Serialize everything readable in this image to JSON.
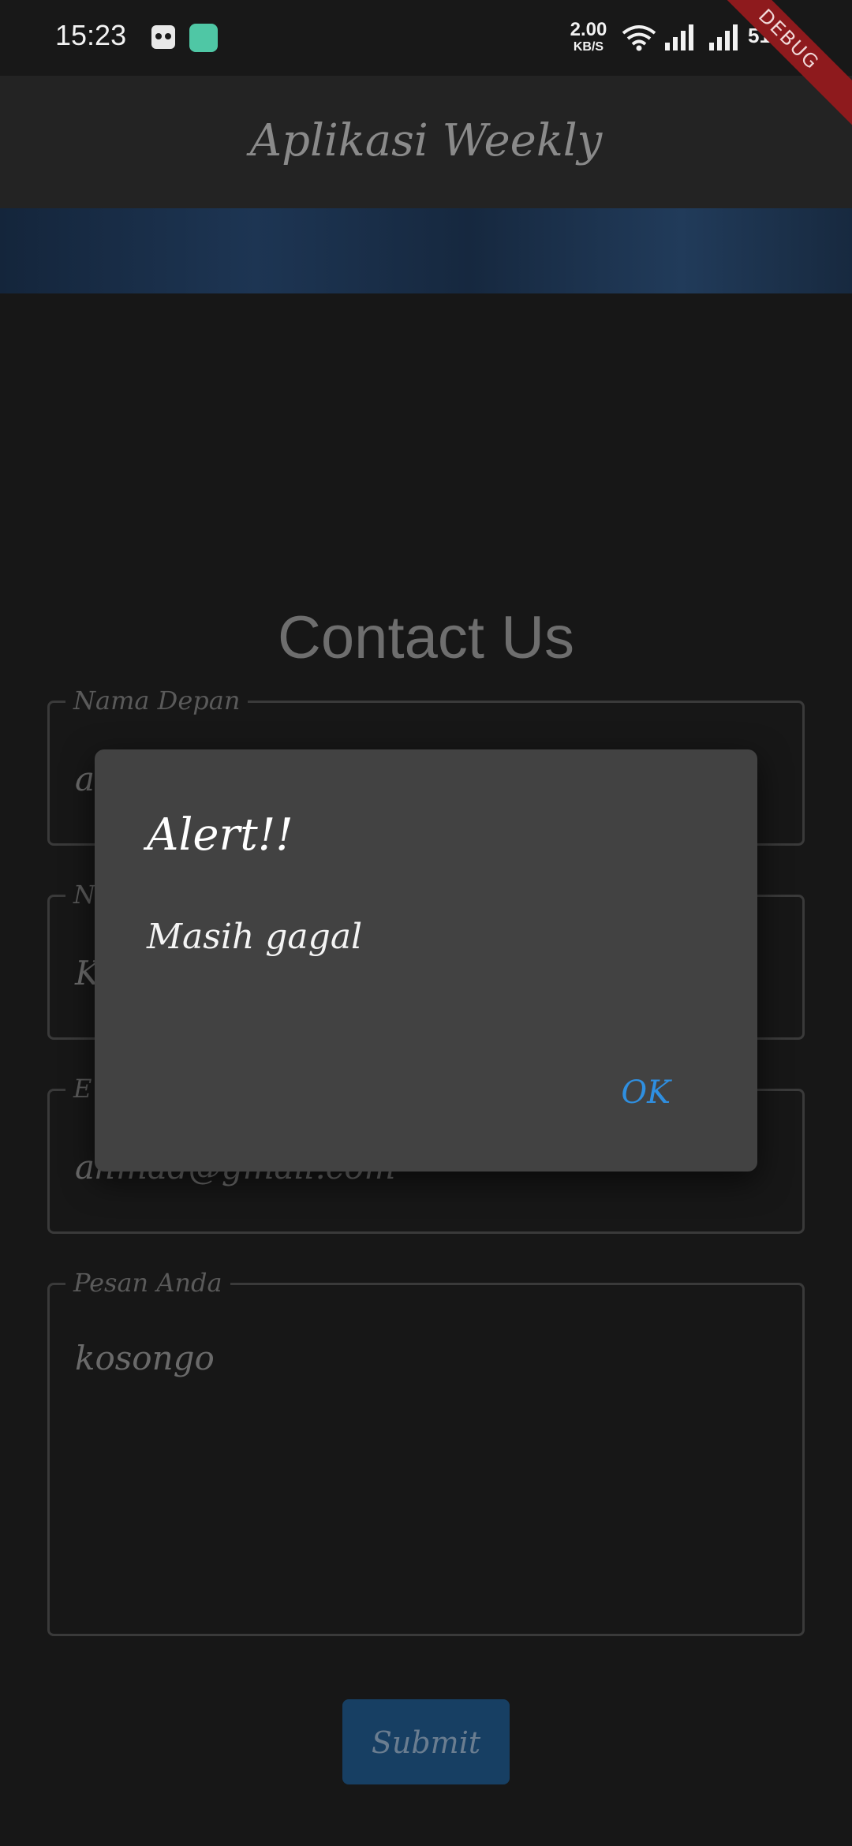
{
  "status_bar": {
    "time": "15:23",
    "net_speed_value": "2.00",
    "net_speed_unit": "KB/S",
    "battery": "51%",
    "icons": [
      "app-notification-icon",
      "app-notification-icon-2",
      "wifi-icon",
      "signal-icon",
      "signal-icon",
      "battery-icon"
    ]
  },
  "debug_banner": "DEBUG",
  "app_bar": {
    "title": "Aplikasi Weekly"
  },
  "page": {
    "heading": "Contact Us"
  },
  "form": {
    "fields": [
      {
        "label": "Nama Depan",
        "value": "a"
      },
      {
        "label": "N",
        "value": "K"
      },
      {
        "label": "E",
        "value": "ahmad@gmail.com"
      },
      {
        "label": "Pesan Anda",
        "value": "kosongo"
      }
    ],
    "submit_label": "Submit"
  },
  "dialog": {
    "title": "Alert!!",
    "content": "Masih gagal",
    "ok_label": "OK"
  },
  "colors": {
    "background": "#171717",
    "app_bar": "#232323",
    "dialog": "#424242",
    "accent": "#2f8fe0",
    "submit": "#173f63"
  }
}
